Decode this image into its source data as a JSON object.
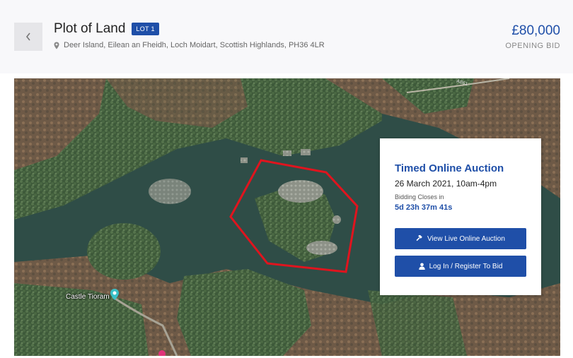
{
  "header": {
    "title": "Plot of Land",
    "lot_badge": "LOT 1",
    "address": "Deer Island, Eilean an Fheidh, Loch Moidart, Scottish Highlands, PH36 4LR",
    "price": "£80,000",
    "price_label": "OPENING BID"
  },
  "map": {
    "castle_label": "Castle Tioram",
    "road_label": "A861",
    "boundary_color": "#e0141e"
  },
  "auction": {
    "title": "Timed Online Auction",
    "date": "26 March 2021, 10am-4pm",
    "closes_label": "Bidding Closes in",
    "countdown": "5d 23h 37m 41s",
    "view_live_label": "View Live Online Auction",
    "login_label": "Log In / Register To Bid"
  },
  "colors": {
    "accent": "#1f4fa8",
    "badge": "#1f4fa8"
  },
  "icons": {
    "back": "chevron-left-icon",
    "pin": "map-pin-icon",
    "gavel": "gavel-icon",
    "user": "user-icon"
  }
}
